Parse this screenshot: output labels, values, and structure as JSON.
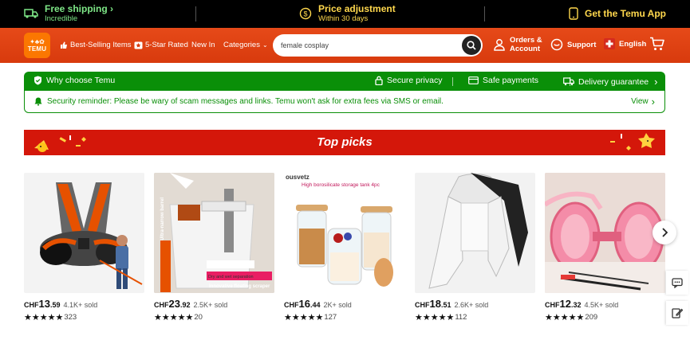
{
  "topbar": {
    "shipping_title": "Free shipping",
    "shipping_sub": "Incredible",
    "price_title": "Price adjustment",
    "price_sub": "Within 30 days",
    "app_label": "Get the Temu App"
  },
  "header": {
    "logo_text": "TEMU",
    "nav": {
      "best_selling": "Best-Selling Items",
      "five_star": "5-Star Rated",
      "new_in": "New In",
      "categories": "Categories"
    },
    "search": {
      "value": "female cosplay"
    },
    "orders": "Orders &",
    "account": "Account",
    "support": "Support",
    "language": "English"
  },
  "why": {
    "label": "Why choose Temu",
    "secure": "Secure privacy",
    "payments": "Safe payments",
    "delivery": "Delivery guarantee"
  },
  "security": {
    "message": "Security reminder: Please be wary of scam messages and links. Temu won't ask for extra fees via SMS or email.",
    "view": "View"
  },
  "top_picks": {
    "title": "Top picks"
  },
  "products": [
    {
      "currency": "CHF",
      "int": "13",
      "dec": ".59",
      "sold": "4.1K+ sold",
      "stars": "★★★★★",
      "reviews": "323"
    },
    {
      "currency": "CHF",
      "int": "23",
      "dec": ".92",
      "sold": "2.5K+ sold",
      "stars": "★★★★★",
      "reviews": "20",
      "badge_1": "Ultra-narrow barrel",
      "badge_2": "Dry and wet separation",
      "badge_3": "Innovative floating scraper"
    },
    {
      "currency": "CHF",
      "int": "16",
      "dec": ".44",
      "sold": "2K+ sold",
      "stars": "★★★★★",
      "reviews": "127",
      "brand": "ousvetz",
      "caption": "High borosilicate storage tank 4pc"
    },
    {
      "currency": "CHF",
      "int": "18",
      "dec": ".51",
      "sold": "2.6K+ sold",
      "stars": "★★★★★",
      "reviews": "112"
    },
    {
      "currency": "CHF",
      "int": "12",
      "dec": ".32",
      "sold": "4.5K+ sold",
      "stars": "★★★★★",
      "reviews": "209"
    }
  ],
  "colors": {
    "brand_orange": "#fb7701",
    "header_red": "#e64a19",
    "trust_green": "#0a8f08",
    "picks_red": "#d4170a"
  }
}
